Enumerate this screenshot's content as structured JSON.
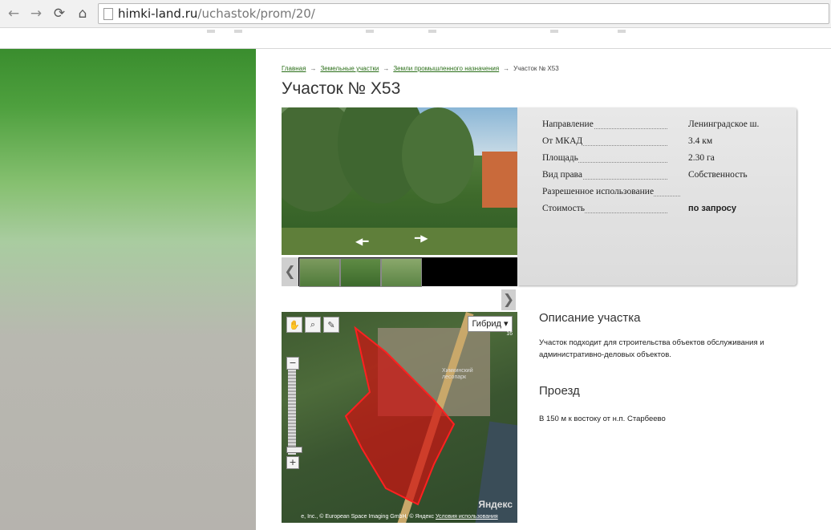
{
  "browser": {
    "url_domain": "himki-land.ru",
    "url_path": "/uchastok/prom/20/",
    "back_icon": "arrow-left",
    "forward_icon": "arrow-right",
    "reload_icon": "reload",
    "home_icon": "home"
  },
  "breadcrumb": {
    "items": [
      "Главная",
      "Земельные участки",
      "Земли промышленного назначения"
    ],
    "current": "Участок № Х53",
    "separator": "→"
  },
  "page_title": "Участок № Х53",
  "gallery": {
    "prev": "❮",
    "next": "❯"
  },
  "info": {
    "rows": [
      {
        "label": "Направление",
        "value": "Ленинградское ш."
      },
      {
        "label": "От МКАД",
        "value": "3.4 км"
      },
      {
        "label": "Площадь",
        "value": "2.30 га"
      },
      {
        "label": "Вид права",
        "value": "Собственность"
      },
      {
        "label": "Разрешенное использование",
        "value": ""
      },
      {
        "label": "Стоимость",
        "value": "по запросу"
      }
    ]
  },
  "map": {
    "type_label": "Гибрид",
    "zoom_minus": "−",
    "zoom_plus": "+",
    "copyright": "e, Inc., © European Space Imaging GmbH, © Яндекс",
    "terms_link": "Условия использования",
    "brand": "Яндекс",
    "place_label": "Химкинский\nлесопарк",
    "zoom_level_label": "16"
  },
  "description": {
    "heading": "Описание участка",
    "text": "Участок подходит для строительства объектов обслуживания и административно-деловых объектов.",
    "travel_heading": "Проезд",
    "travel_text": "В 150 м к востоку от н.п. Старбеево"
  },
  "colors": {
    "green_top": "#3a8d2e",
    "parcel_red": "#d01010",
    "link_green": "#2a6e18"
  }
}
